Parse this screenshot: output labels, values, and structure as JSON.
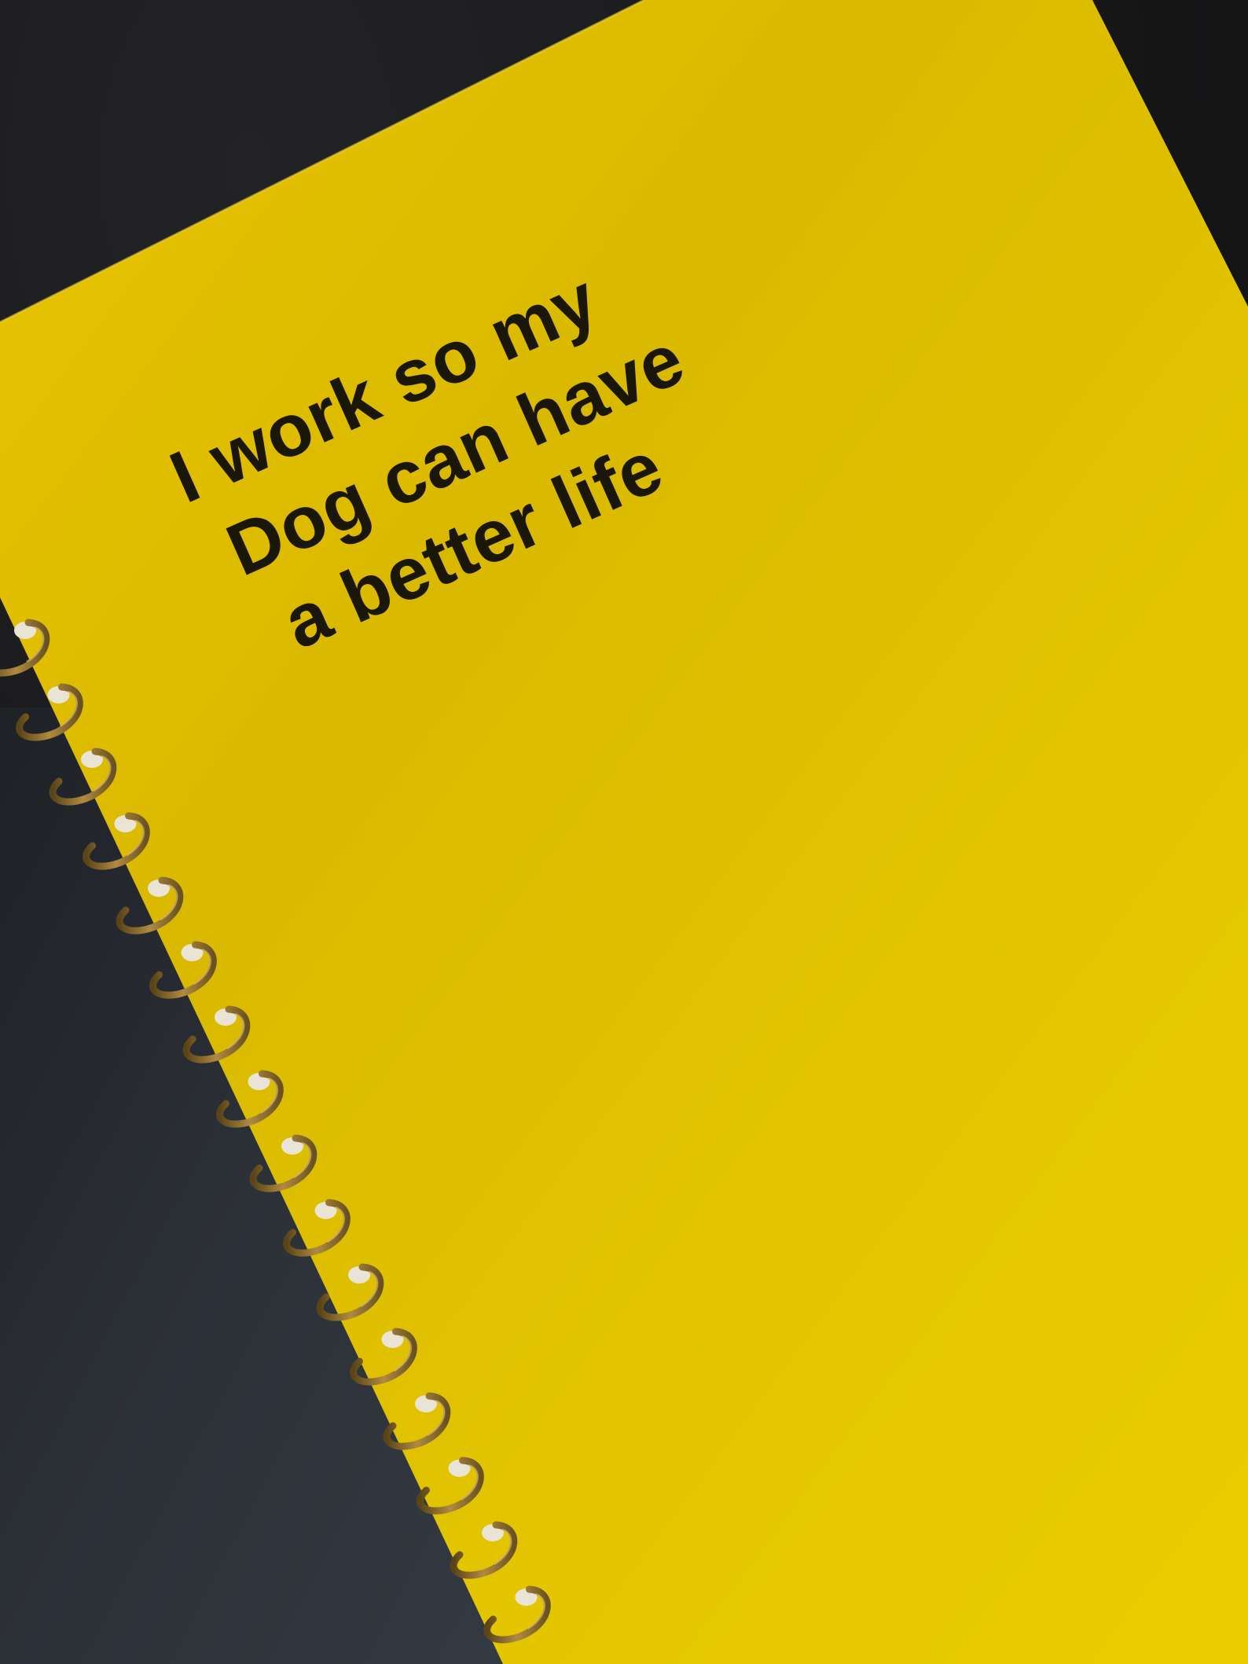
{
  "photo": {
    "subject": "",
    "cover": {
      "color": "#e8c800",
      "text_lines": [
        "I work so my",
        "Dog can have",
        "a better life"
      ]
    },
    "back_cover_color": "#2a2e34",
    "binding": {
      "color": "#8a6a2e"
    },
    "background_color": "#161617"
  }
}
